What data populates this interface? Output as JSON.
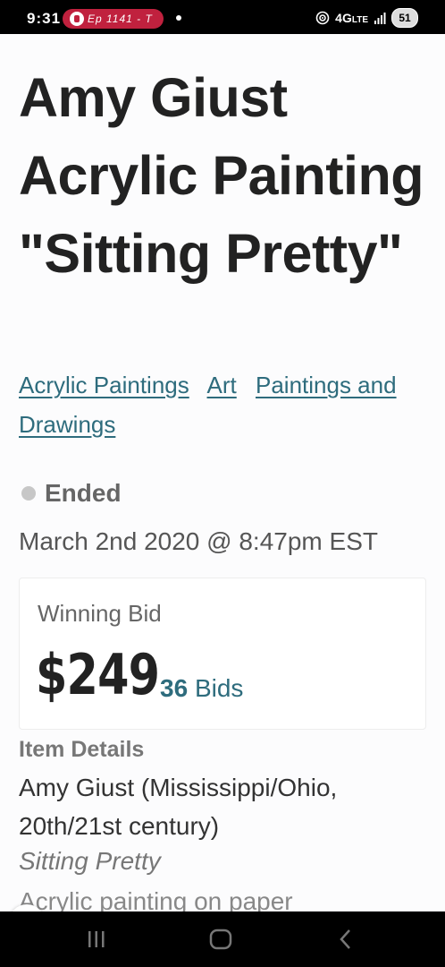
{
  "status_bar": {
    "time": "9:31",
    "notification_text": "Ep 1141 - T",
    "network": "4G",
    "network_sub": "LTE",
    "battery": "51"
  },
  "listing": {
    "title": "Amy Giust Acrylic Painting \"Sitting Pretty\"",
    "tags": [
      "Acrylic Paintings",
      "Art",
      "Paintings and Drawings"
    ],
    "status": "Ended",
    "end_date": "March 2nd 2020 @ 8:47pm EST",
    "bid": {
      "label": "Winning Bid",
      "amount": "$249",
      "count": "36",
      "count_suffix": "Bids"
    }
  },
  "details": {
    "heading": "Item Details",
    "artist": "Amy Giust (Mississippi/Ohio, 20th/21st century)",
    "artwork_title": "Sitting Pretty",
    "medium": "Acrylic painting on paper"
  },
  "icons": {
    "cookie": "cookie-icon",
    "recents": "recents-icon",
    "home": "home-icon",
    "back": "back-icon"
  },
  "colors": {
    "accent": "#2e6c7d",
    "notification": "#c0213e",
    "status_dot": "#c7c7c7"
  }
}
